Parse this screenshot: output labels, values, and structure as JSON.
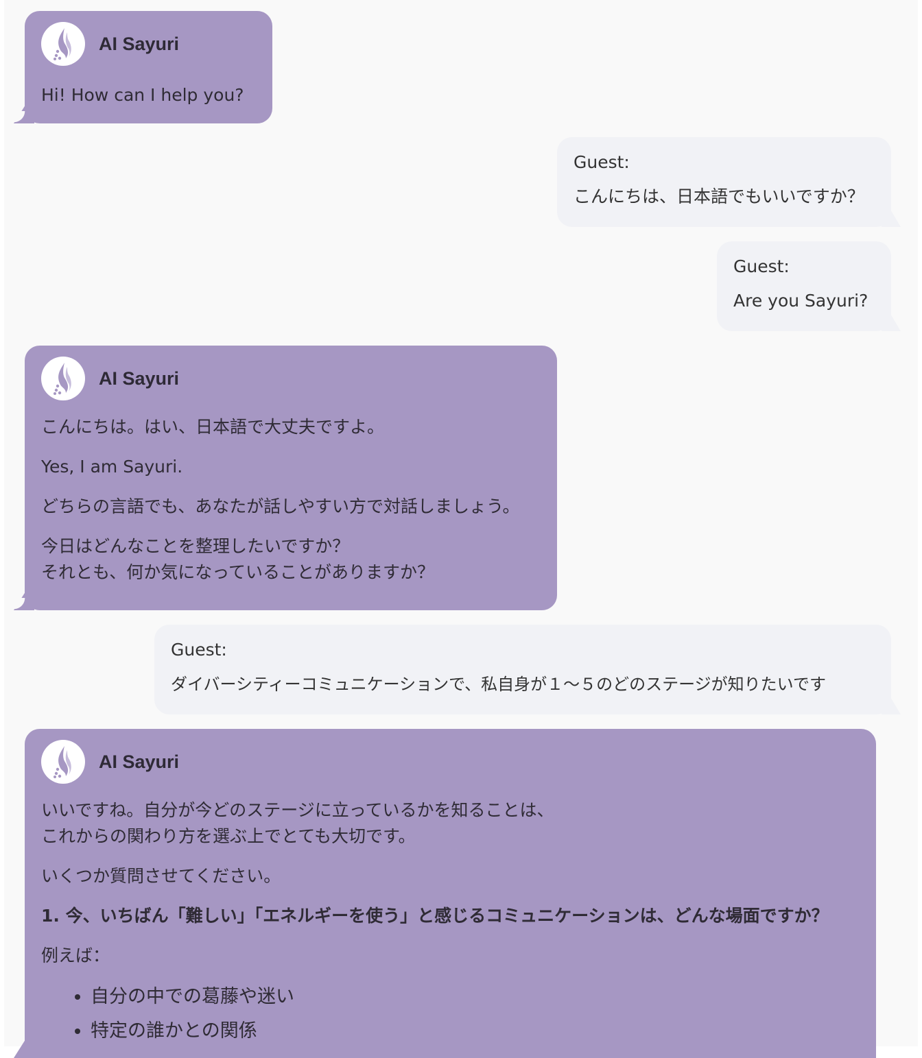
{
  "bot": {
    "name": "AI Sayuri",
    "avatar_icon": "sayuri-flame-logo-icon",
    "bubble_color": "#a697c3"
  },
  "guest": {
    "label": "Guest:",
    "bubble_color": "#f1f2f6"
  },
  "messages": [
    {
      "sender": "bot",
      "lines": [
        "Hi! How can I help you?"
      ]
    },
    {
      "sender": "guest",
      "text": "こんにちは、日本語でもいいですか？"
    },
    {
      "sender": "guest",
      "text": "Are you Sayuri?"
    },
    {
      "sender": "bot",
      "paragraphs": [
        "こんにちは。はい、日本語で大丈夫ですよ。",
        "Yes, I am Sayuri.",
        "どちらの言語でも、あなたが話しやすい方で対話しましょう。",
        "今日はどんなことを整理したいですか？",
        "それとも、何か気になっていることがありますか？"
      ]
    },
    {
      "sender": "guest",
      "text": "ダイバーシティーコミュニケーションで、私自身が１～５のどのステージが知りたいです"
    },
    {
      "sender": "bot",
      "paragraphs": [
        "いいですね。自分が今どのステージに立っているかを知ることは、",
        "これからの関わり方を選ぶ上でとても大切です。",
        "いくつか質問させてください。",
        "1. 今、いちばん「難しい」「エネルギーを使う」と感じるコミュニケーションは、どんな場面ですか？",
        "例えば："
      ],
      "bullets": [
        "自分の中での葛藤や迷い",
        "特定の誰かとの関係"
      ]
    }
  ]
}
